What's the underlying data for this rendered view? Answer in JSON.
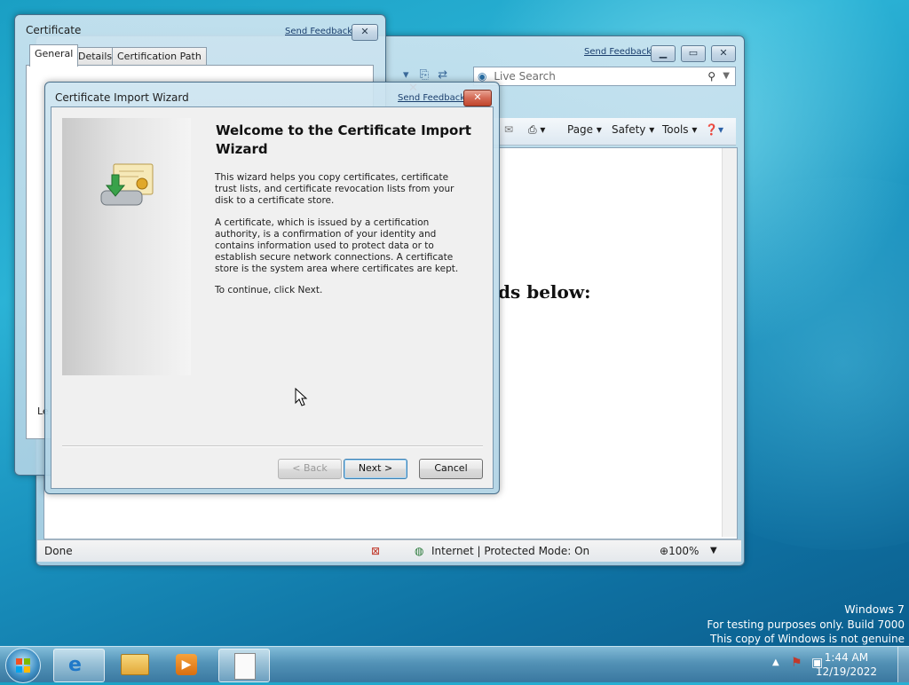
{
  "ie_window": {
    "send_feedback": "Send Feedback",
    "search_placeholder": "Live Search",
    "toolbar": {
      "page": "Page",
      "safety": "Safety",
      "tools": "Tools"
    },
    "page_heading_fragment": "ds below:",
    "status": {
      "left": "Done",
      "zone": "Internet | Protected Mode: On",
      "zoom": "100%"
    }
  },
  "cert_window": {
    "title": "Certificate",
    "send_feedback": "Send Feedback",
    "tabs": [
      "General",
      "Details",
      "Certification Path"
    ],
    "partial_label": "Le"
  },
  "wizard": {
    "title": "Certificate Import Wizard",
    "send_feedback": "Send Feedback",
    "heading": "Welcome to the Certificate Import Wizard",
    "para1": "This wizard helps you copy certificates, certificate trust lists, and certificate revocation lists from your disk to a certificate store.",
    "para2": "A certificate, which is issued by a certification authority, is a confirmation of your identity and contains information used to protect data or to establish secure network connections. A certificate store is the system area where certificates are kept.",
    "para3": "To continue, click Next.",
    "buttons": {
      "back": "< Back",
      "next": "Next >",
      "cancel": "Cancel"
    }
  },
  "watermark": {
    "line1": "Windows 7",
    "line2": "For testing purposes only. Build 7000",
    "line3": "This copy of Windows is not genuine"
  },
  "taskbar": {
    "time": "1:44 AM",
    "date": "12/19/2022"
  }
}
